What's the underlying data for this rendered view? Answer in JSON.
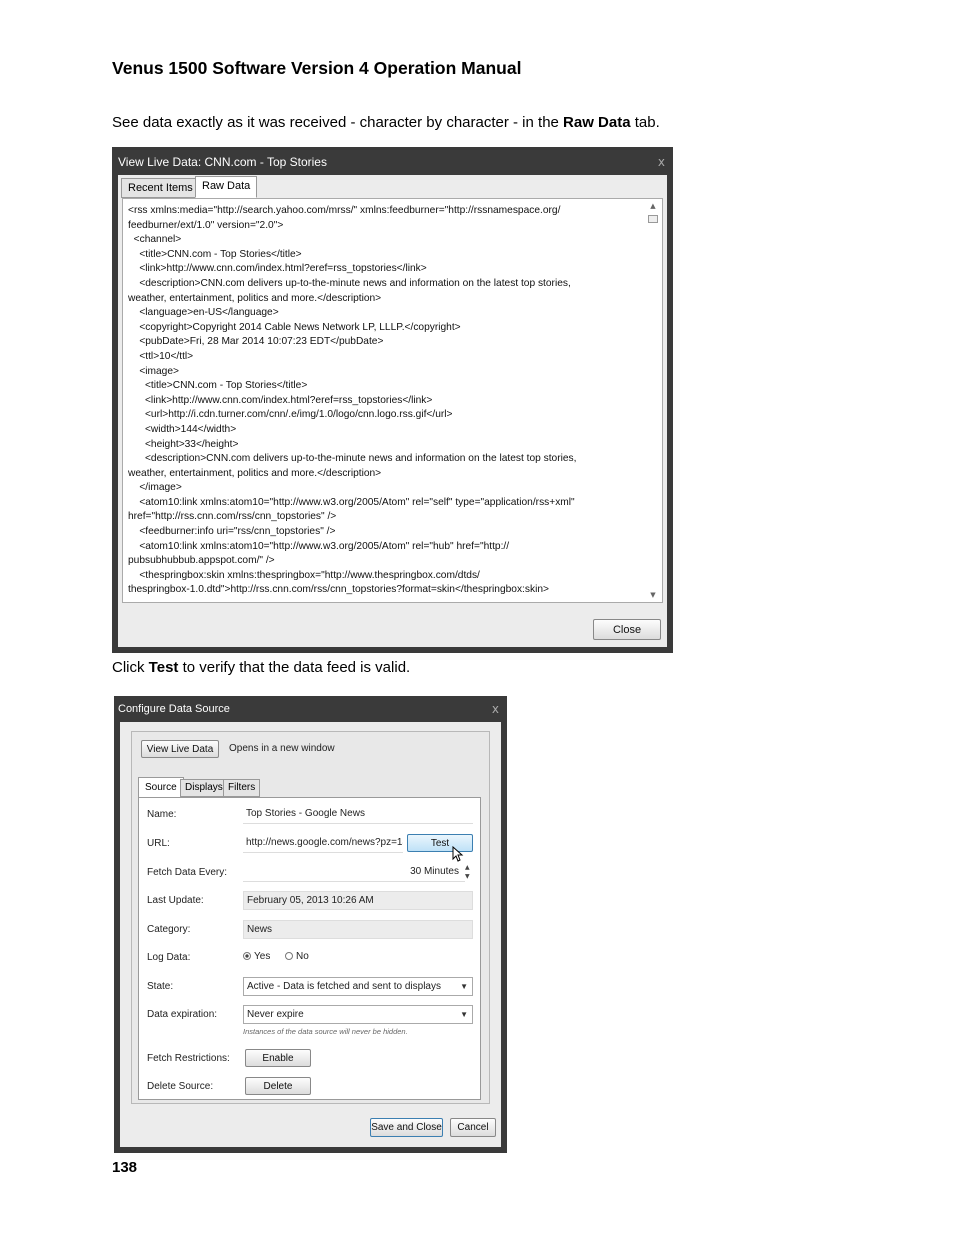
{
  "doc": {
    "title": "Venus 1500 Software Version 4 Operation Manual",
    "para1_pre": "See data exactly as it was received - character by character - in the ",
    "para1_bold": "Raw Data",
    "para1_post": " tab.",
    "para2_pre": "Click ",
    "para2_bold": "Test",
    "para2_post": " to verify that the data feed is valid.",
    "page_number": "138"
  },
  "live_window": {
    "title": "View Live Data: CNN.com - Top Stories",
    "close_glyph": "x",
    "tabs": [
      "Recent Items",
      "Raw Data"
    ],
    "raw_text": "<rss xmlns:media=\"http://search.yahoo.com/mrss/\" xmlns:feedburner=\"http://rssnamespace.org/\nfeedburner/ext/1.0\" version=\"2.0\">\n  <channel>\n    <title>CNN.com - Top Stories</title>\n    <link>http://www.cnn.com/index.html?eref=rss_topstories</link>\n    <description>CNN.com delivers up-to-the-minute news and information on the latest top stories,\nweather, entertainment, politics and more.</description>\n    <language>en-US</language>\n    <copyright>Copyright 2014 Cable News Network LP, LLLP.</copyright>\n    <pubDate>Fri, 28 Mar 2014 10:07:23 EDT</pubDate>\n    <ttl>10</ttl>\n    <image>\n      <title>CNN.com - Top Stories</title>\n      <link>http://www.cnn.com/index.html?eref=rss_topstories</link>\n      <url>http://i.cdn.turner.com/cnn/.e/img/1.0/logo/cnn.logo.rss.gif</url>\n      <width>144</width>\n      <height>33</height>\n      <description>CNN.com delivers up-to-the-minute news and information on the latest top stories,\nweather, entertainment, politics and more.</description>\n    </image>\n    <atom10:link xmlns:atom10=\"http://www.w3.org/2005/Atom\" rel=\"self\" type=\"application/rss+xml\"\nhref=\"http://rss.cnn.com/rss/cnn_topstories\" />\n    <feedburner:info uri=\"rss/cnn_topstories\" />\n    <atom10:link xmlns:atom10=\"http://www.w3.org/2005/Atom\" rel=\"hub\" href=\"http://\npubsubhubbub.appspot.com/\" />\n    <thespringbox:skin xmlns:thespringbox=\"http://www.thespringbox.com/dtds/\nthespringbox-1.0.dtd\">http://rss.cnn.com/rss/cnn_topstories?format=skin</thespringbox:skin>",
    "close_button": "Close"
  },
  "config_window": {
    "title": "Configure Data Source",
    "close_glyph": "x",
    "view_live_button": "View Live Data",
    "view_live_hint": "Opens in a new window",
    "tabs": [
      "Source",
      "Displays",
      "Filters"
    ],
    "name_label": "Name:",
    "name_value": "Top Stories - Google News",
    "url_label": "URL:",
    "url_value": "http://news.google.com/news?pz=1&",
    "test_button": "Test",
    "fetch_label": "Fetch Data Every:",
    "fetch_value": "30 Minutes",
    "last_update_label": "Last Update:",
    "last_update_value": "February 05, 2013 10:26 AM",
    "category_label": "Category:",
    "category_value": "News",
    "log_label": "Log Data:",
    "log_yes": "Yes",
    "log_no": "No",
    "state_label": "State:",
    "state_value": "Active - Data is fetched and sent to displays",
    "expiration_label": "Data expiration:",
    "expiration_value": "Never expire",
    "expiration_hint": "Instances of the data source will never be hidden.",
    "restrictions_label": "Fetch Restrictions:",
    "enable_button": "Enable",
    "delete_label": "Delete Source:",
    "delete_button": "Delete",
    "save_button": "Save and Close",
    "cancel_button": "Cancel"
  }
}
